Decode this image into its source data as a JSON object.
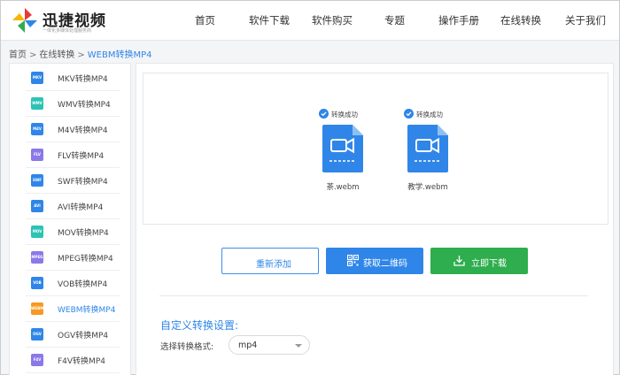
{
  "brand": {
    "name": "迅捷视频",
    "slogan": "一体化多媒体处理服务商",
    "logo_icon": "four-color-pinwheel-icon"
  },
  "nav": {
    "items": [
      {
        "label": "首页"
      },
      {
        "label": "软件下载"
      },
      {
        "label": "软件购买"
      },
      {
        "label": "专题"
      },
      {
        "label": "操作手册"
      },
      {
        "label": "在线转换"
      },
      {
        "label": "关于我们"
      }
    ]
  },
  "breadcrumb": {
    "home": "首页",
    "sep1": ">",
    "section": "在线转换",
    "sep2": ">",
    "current": "WEBM转换MP4"
  },
  "sidebar": {
    "items": [
      {
        "label": "MKV转换MP4",
        "tag": "MKV",
        "color": "#2f86e8"
      },
      {
        "label": "WMV转换MP4",
        "tag": "WMV",
        "color": "#2cc3b5"
      },
      {
        "label": "M4V转换MP4",
        "tag": "M4V",
        "color": "#2f86e8"
      },
      {
        "label": "FLV转换MP4",
        "tag": "FLV",
        "color": "#8a79e8"
      },
      {
        "label": "SWF转换MP4",
        "tag": "SWF",
        "color": "#2f86e8"
      },
      {
        "label": "AVI转换MP4",
        "tag": "AVI",
        "color": "#2f86e8"
      },
      {
        "label": "MOV转换MP4",
        "tag": "MOV",
        "color": "#2cc3b5"
      },
      {
        "label": "MPEG转换MP4",
        "tag": "MPEG",
        "color": "#8a79e8"
      },
      {
        "label": "VOB转换MP4",
        "tag": "VOB",
        "color": "#2f86e8"
      },
      {
        "label": "WEBM转换MP4",
        "tag": "WEBM",
        "color": "#f59a23",
        "active": true
      },
      {
        "label": "OGV转换MP4",
        "tag": "OGV",
        "color": "#2f86e8"
      },
      {
        "label": "F4V转换MP4",
        "tag": "F4V",
        "color": "#8a79e8"
      }
    ]
  },
  "files": [
    {
      "status": "转换成功",
      "name": "茶.webm",
      "icon": "video-file-icon"
    },
    {
      "status": "转换成功",
      "name": "教学.webm",
      "icon": "video-file-icon"
    }
  ],
  "buttons": {
    "readd": "重新添加",
    "qr": "获取二维码",
    "download": "立即下载"
  },
  "settings": {
    "title": "自定义转换设置:",
    "format_label": "选择转换格式:",
    "format_value": "mp4"
  },
  "colors": {
    "accent": "#2f86e8",
    "success": "#2eae4e"
  }
}
